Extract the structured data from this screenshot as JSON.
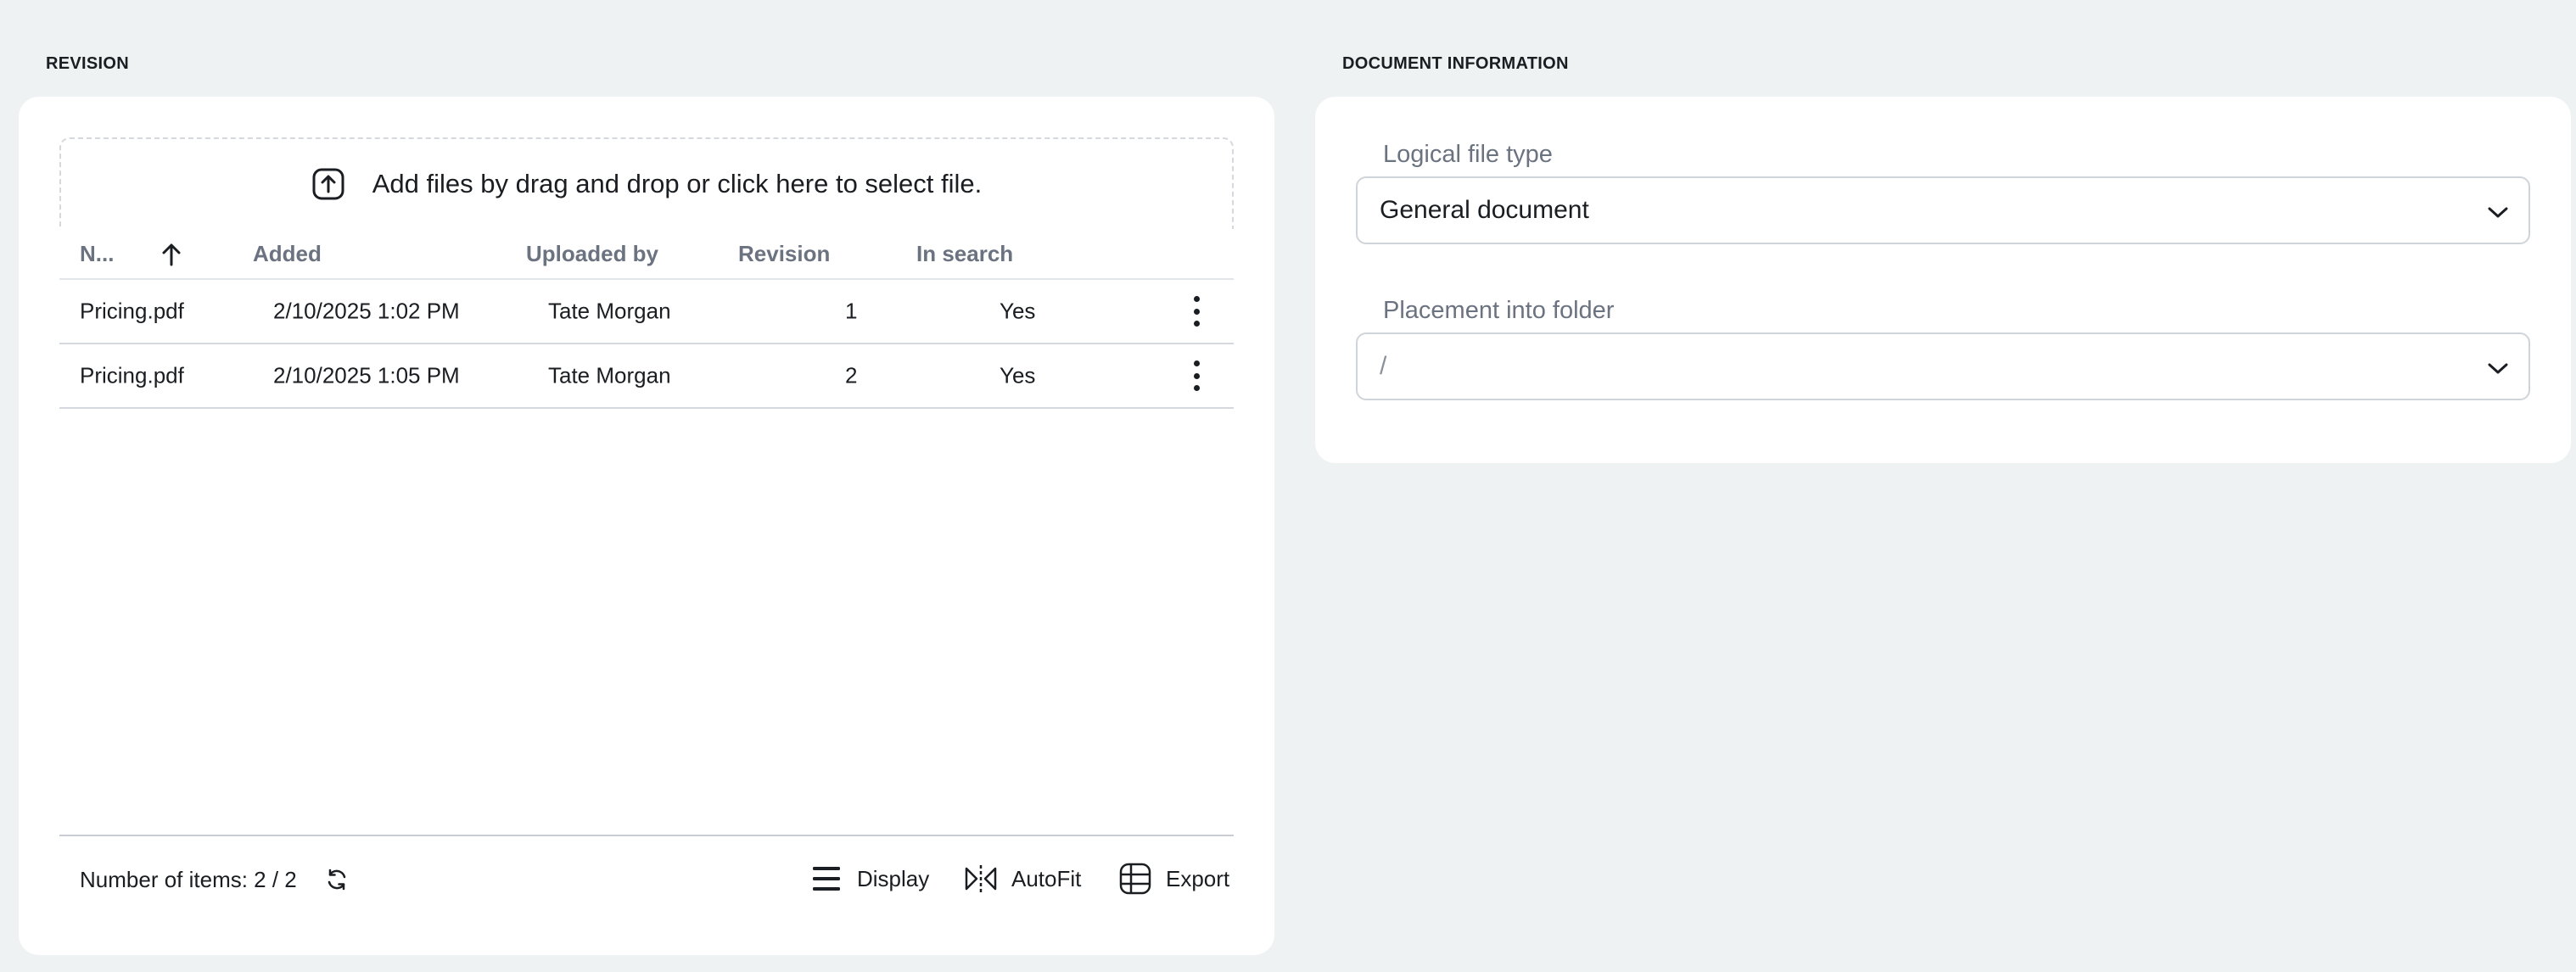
{
  "revision": {
    "section_title": "REVISION",
    "dropzone_text": "Add files by drag and drop or click here to select file.",
    "columns": {
      "name": "N...",
      "added": "Added",
      "uploaded_by": "Uploaded by",
      "revision": "Revision",
      "in_search": "In search"
    },
    "rows": [
      {
        "name": "Pricing.pdf",
        "added": "2/10/2025 1:02 PM",
        "uploaded_by": "Tate Morgan",
        "revision": "1",
        "in_search": "Yes"
      },
      {
        "name": "Pricing.pdf",
        "added": "2/10/2025 1:05 PM",
        "uploaded_by": "Tate Morgan",
        "revision": "2",
        "in_search": "Yes"
      }
    ],
    "footer": {
      "count_text": "Number of items: 2 / 2",
      "display_label": "Display",
      "autofit_label": "AutoFit",
      "export_label": "Export"
    }
  },
  "document_information": {
    "section_title": "DOCUMENT INFORMATION",
    "logical_file_type": {
      "label": "Logical file type",
      "value": "General document"
    },
    "placement": {
      "label": "Placement into folder",
      "value": "/"
    }
  },
  "icons": {
    "upload": "upload-icon",
    "sort": "arrow-up-icon",
    "row_menu": "more-vertical-icon",
    "refresh": "refresh-icon",
    "display": "hamburger-icon",
    "autofit": "autofit-icon",
    "export": "table-grid-icon",
    "chevron": "chevron-down-icon"
  }
}
